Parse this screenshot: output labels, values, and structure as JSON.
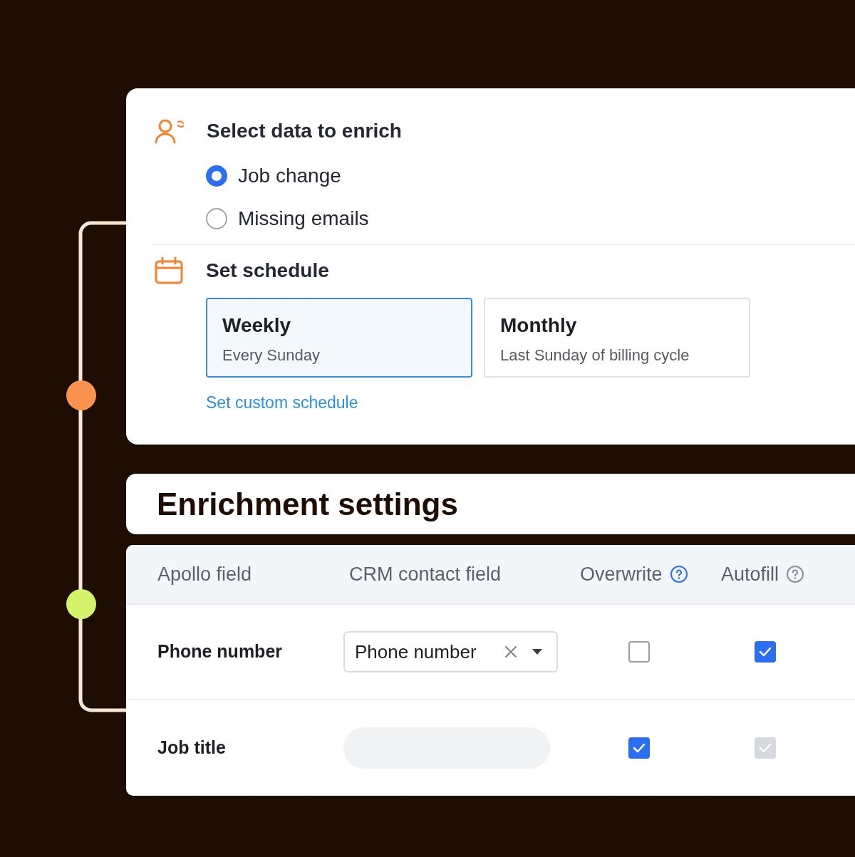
{
  "enrich": {
    "title": "Select data to enrich",
    "options": [
      {
        "label": "Job change",
        "selected": true
      },
      {
        "label": "Missing emails",
        "selected": false
      }
    ]
  },
  "schedule": {
    "title": "Set schedule",
    "options": [
      {
        "title": "Weekly",
        "subtitle": "Every Sunday",
        "selected": true
      },
      {
        "title": "Monthly",
        "subtitle": "Last Sunday of billing cycle",
        "selected": false
      }
    ],
    "custom_link": "Set custom schedule"
  },
  "settings": {
    "title": "Enrichment settings",
    "columns": [
      {
        "label": "Apollo field"
      },
      {
        "label": "CRM contact field"
      },
      {
        "label": "Overwrite",
        "help_icon": {
          "highlighted": true
        }
      },
      {
        "label": "Autofill",
        "help_icon": {
          "highlighted": false
        }
      }
    ],
    "rows": [
      {
        "apollo_field": "Phone number",
        "crm_field": {
          "kind": "select",
          "value": "Phone number"
        },
        "overwrite": {
          "checked": false,
          "disabled": false
        },
        "autofill": {
          "checked": true,
          "disabled": false
        }
      },
      {
        "apollo_field": "Job title",
        "crm_field": {
          "kind": "skeleton"
        },
        "overwrite": {
          "checked": true,
          "disabled": false
        },
        "autofill": {
          "checked": true,
          "disabled": true
        }
      }
    ]
  }
}
